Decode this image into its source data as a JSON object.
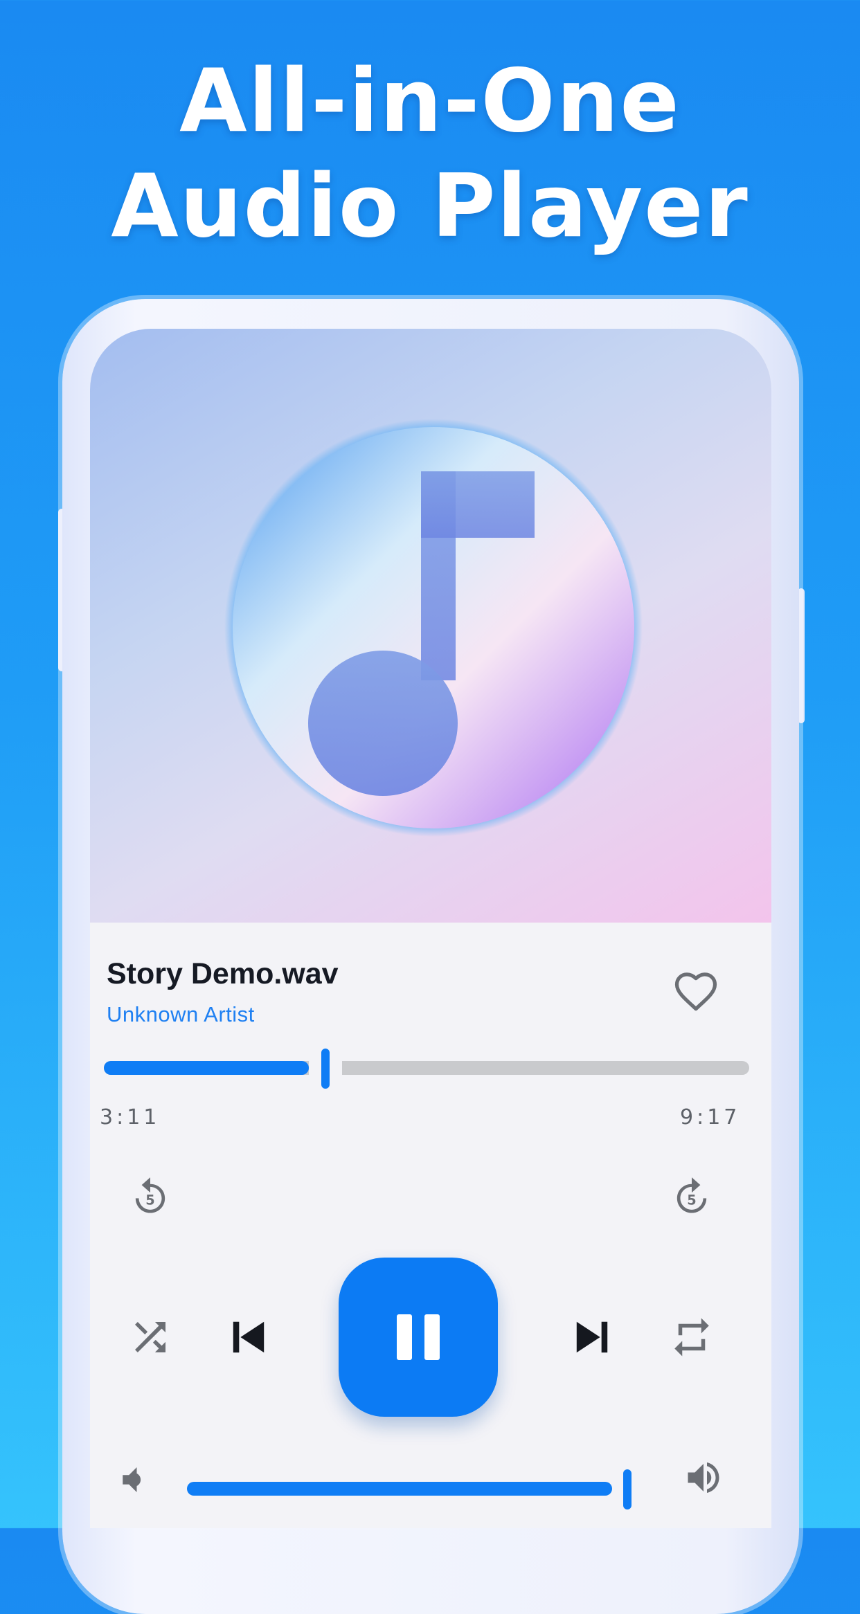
{
  "headline": {
    "line1": "All-in-One",
    "line2": "Audio Player"
  },
  "player": {
    "track_title": "Story Demo.wav",
    "artist": "Unknown Artist",
    "elapsed": "3:11",
    "duration": "9:17",
    "progress_fraction": 0.343,
    "volume_fraction": 0.9,
    "rewind_label": "5",
    "forward_label": "5",
    "is_playing": true,
    "favorited": false
  },
  "icons": {
    "album_art": "music-note-disc",
    "favorite": "heart-outline-icon",
    "rewind": "replay-5-icon",
    "forward": "forward-5-icon",
    "shuffle": "shuffle-icon",
    "previous": "skip-previous-icon",
    "play_pause": "pause-icon",
    "next": "skip-next-icon",
    "repeat": "repeat-icon",
    "volume_low": "volume-low-icon",
    "volume_high": "volume-high-icon"
  },
  "colors": {
    "accent": "#0f7df5",
    "background_top": "#1a8af2",
    "background_bottom": "#35c3fc",
    "icon_gray": "#6b6e74",
    "icon_dark": "#15181f",
    "track_gray": "#c9cacd"
  }
}
